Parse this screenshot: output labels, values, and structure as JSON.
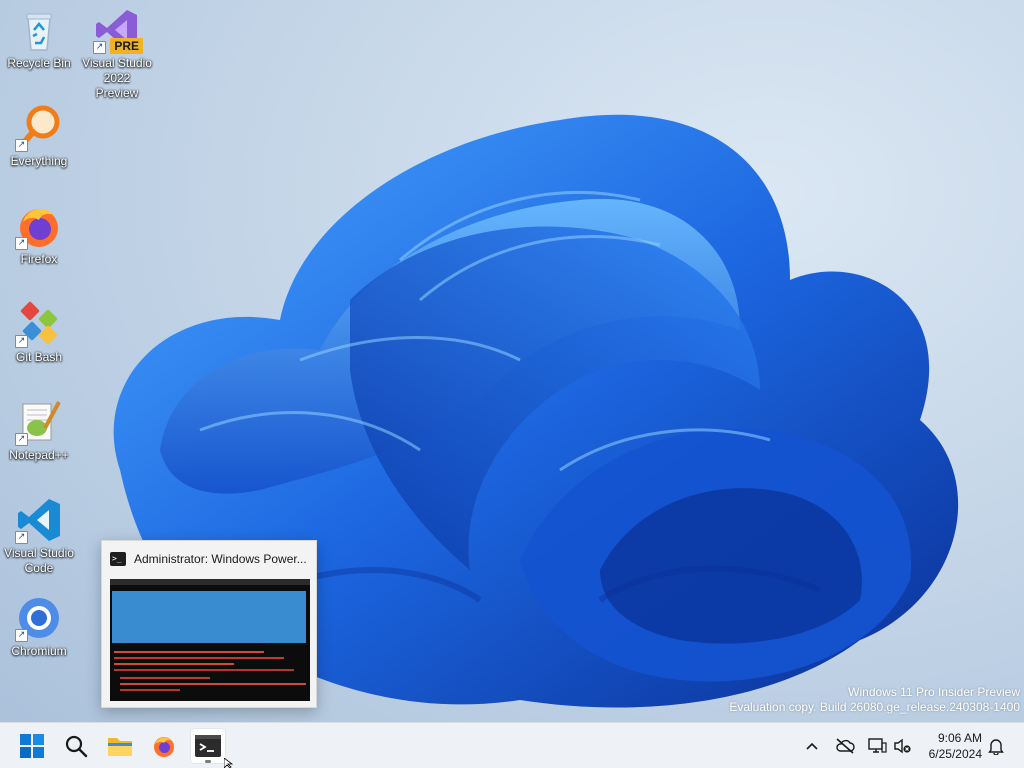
{
  "desktop": {
    "icons": [
      {
        "label": "Recycle Bin",
        "icon": "recycle-bin-icon"
      },
      {
        "label": "Visual Studio 2022 Preview",
        "label_line1": "Visual Studio",
        "label_line2": "2022 Preview",
        "badge": "PRE",
        "icon": "visual-studio-preview-icon"
      },
      {
        "label": "Everything",
        "icon": "everything-search-icon"
      },
      {
        "label": "Firefox",
        "icon": "firefox-icon"
      },
      {
        "label": "Git Bash",
        "icon": "git-bash-icon"
      },
      {
        "label": "Notepad++",
        "icon": "notepad-plus-plus-icon"
      },
      {
        "label": "Visual Studio Code",
        "label_line1": "Visual Studio",
        "label_line2": "Code",
        "icon": "vscode-icon"
      },
      {
        "label": "Chromium",
        "icon": "chromium-icon"
      }
    ]
  },
  "thumbnail": {
    "title": "Administrator: Windows Power..."
  },
  "watermark": {
    "line1": "Windows 11 Pro Insider Preview",
    "line2": "Evaluation copy. Build 26080.ge_release.240308-1400"
  },
  "taskbar": {
    "apps": [
      "start-icon",
      "search-icon",
      "file-explorer-icon",
      "firefox-icon",
      "terminal-icon"
    ],
    "active_app": "terminal-icon"
  },
  "tray": {
    "icons": [
      "chevron-up-icon",
      "cloud-offline-icon",
      "network-icon",
      "volume-muted-icon",
      "notification-bell-icon"
    ],
    "time": "9:06 AM",
    "date": "6/25/2024"
  },
  "colors": {
    "bloom_blue": "#1e6fe8",
    "bloom_dark": "#0a3aa8",
    "taskbar_bg": "#eef1f5",
    "windows_blue": "#0078d4"
  }
}
